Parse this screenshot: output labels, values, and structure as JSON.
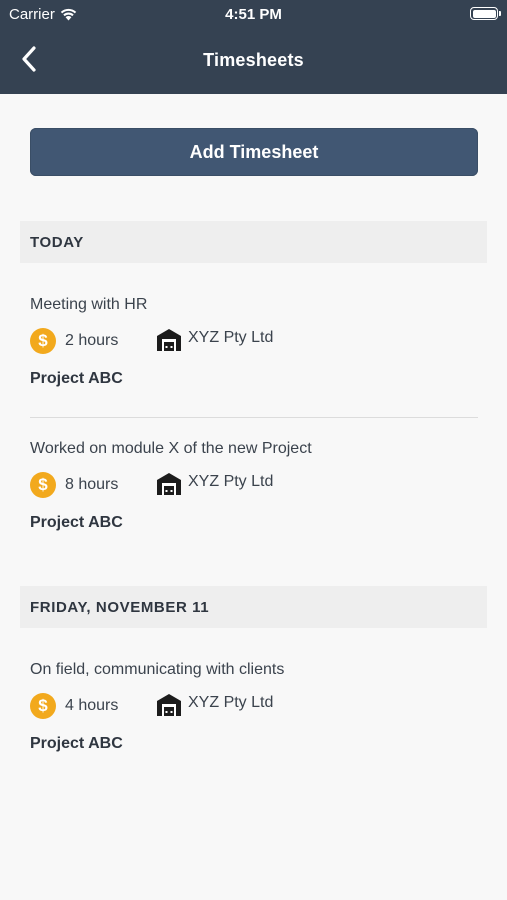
{
  "status_bar": {
    "carrier": "Carrier",
    "time": "4:51 PM"
  },
  "nav": {
    "title": "Timesheets"
  },
  "add_button": {
    "label": "Add Timesheet"
  },
  "sections": [
    {
      "title": "TODAY",
      "entries": [
        {
          "description": "Meeting with HR",
          "hours": "2 hours",
          "company": "XYZ Pty Ltd",
          "project": "Project ABC"
        },
        {
          "description": "Worked on module X of the new Project",
          "hours": "8 hours",
          "company": "XYZ Pty Ltd",
          "project": "Project ABC"
        }
      ]
    },
    {
      "title": "FRIDAY, NOVEMBER 11",
      "entries": [
        {
          "description": "On field, communicating with clients",
          "hours": "4 hours",
          "company": "XYZ Pty Ltd",
          "project": "Project ABC"
        }
      ]
    }
  ],
  "icons": {
    "hours": "dollar-coin-icon",
    "company": "garage-icon",
    "back": "chevron-left-icon"
  },
  "colors": {
    "header": "#354252",
    "button": "#415773",
    "coin": "#f2a91d"
  },
  "coin_symbol": "$"
}
